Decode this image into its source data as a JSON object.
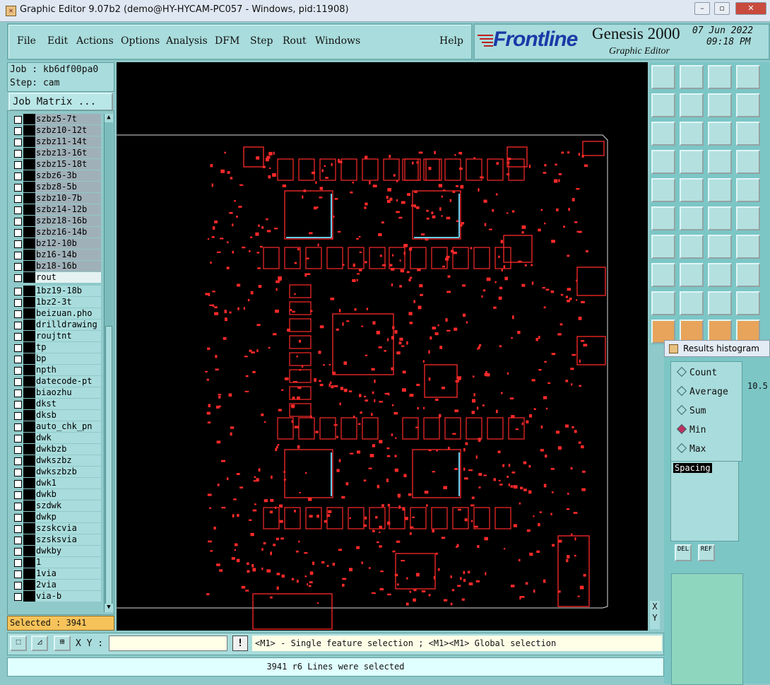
{
  "window": {
    "title": "Graphic Editor 9.07b2 (demo@HY-HYCAM-PC057 - Windows, pid:11908)"
  },
  "menu": [
    "File",
    "Edit",
    "Actions",
    "Options",
    "Analysis",
    "DFM",
    "Step",
    "Rout",
    "Windows"
  ],
  "help_label": "Help",
  "logo": {
    "brand": "Frontline",
    "product": "Genesis 2000",
    "subtitle": "Graphic Editor",
    "date": "07 Jun 2022",
    "time": "09:18 PM"
  },
  "job": {
    "job_line": "Job : kb6df00pa0",
    "step_line": "Step: cam",
    "matrix_label": "Job Matrix ..."
  },
  "layers_top": [
    "szbz5-7t",
    "szbz10-12t",
    "szbz11-14t",
    "szbz13-16t",
    "szbz15-18t",
    "szbz6-3b",
    "szbz8-5b",
    "szbz10-7b",
    "szbz14-12b",
    "szbz18-16b",
    "szbz16-14b",
    "bz12-10b",
    "bz16-14b",
    "bz18-16b",
    "rout"
  ],
  "layers_bottom": [
    "1bz19-18b",
    "1bz2-3t",
    "beizuan.pho",
    "drilldrawing",
    "roujtnt",
    "tp",
    "bp",
    "npth",
    "datecode-pt",
    "biaozhu",
    "dkst",
    "dksb",
    "auto_chk_pn",
    "dwk",
    "dwkbzb",
    "dwkszbz",
    "dwkszbzb",
    "dwk1",
    "dwkb",
    "szdwk",
    "dwkp",
    "szskcvia",
    "szsksvia",
    "dwkby",
    "1",
    "1via",
    "2via",
    "via-b"
  ],
  "selected_label": "Selected : 3941",
  "xy_label": "X Y :",
  "xy_readout": "X\nY",
  "hint": "<M1> - Single feature selection ; <M1><M1> Global selection",
  "status": "3941 r6 Lines were selected",
  "histogram": {
    "title": "Results histogram",
    "options": [
      "Count",
      "Average",
      "Sum",
      "Min",
      "Max"
    ],
    "selected": "Min",
    "list_item": "Spacing",
    "del": "DEL",
    "ref": "REF",
    "side_value": "10.5"
  },
  "colors": {
    "accent": "#a9dcdc",
    "pcb": "#ff2a2a",
    "selected": "#f6c35a"
  }
}
